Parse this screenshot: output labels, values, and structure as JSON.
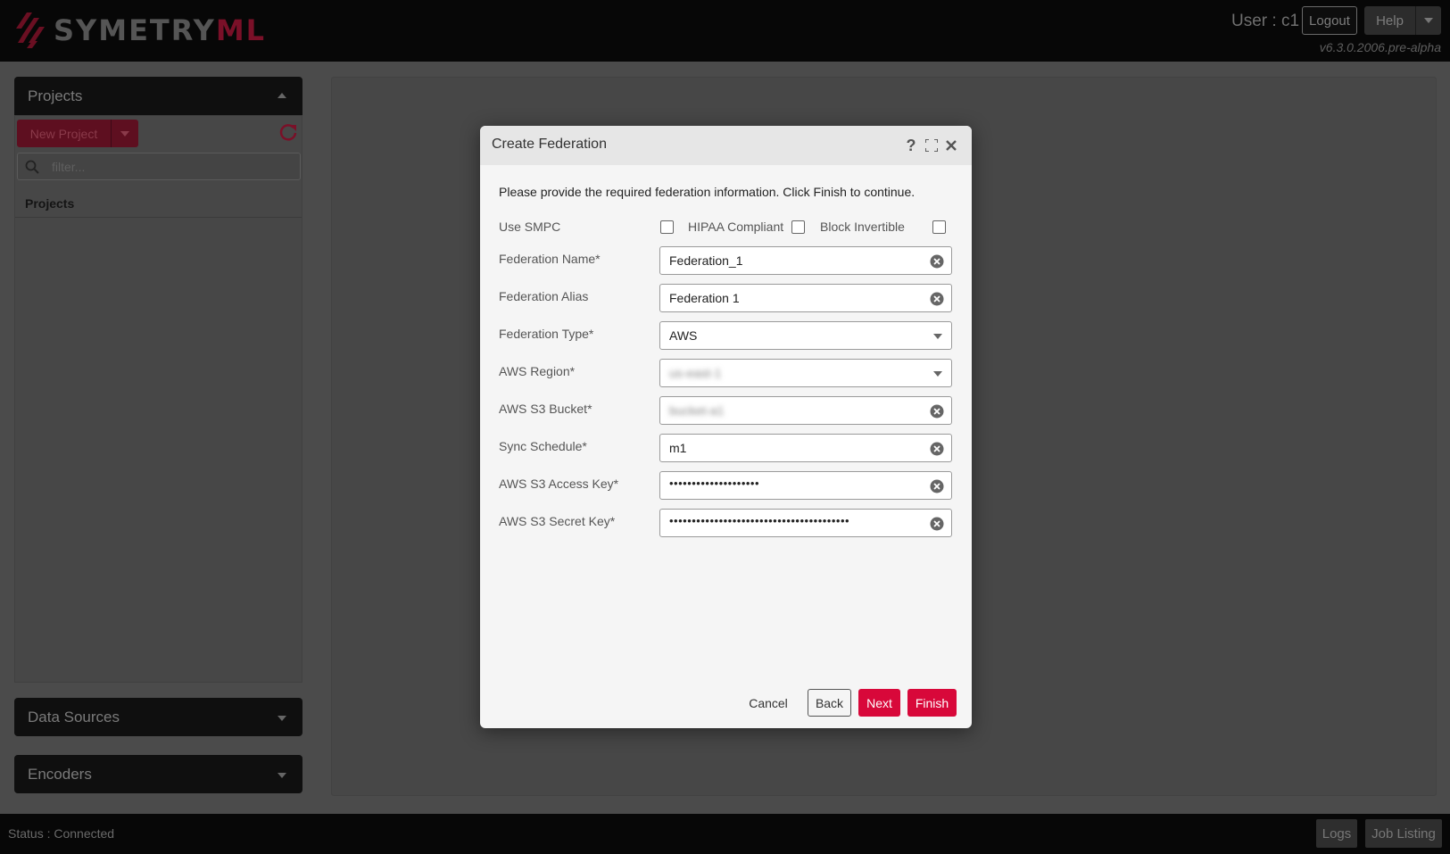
{
  "header": {
    "logo_text_main": "SYMETRY",
    "logo_text_accent": "ML",
    "user_label": "User : c1",
    "logout_label": "Logout",
    "help_label": "Help",
    "version": "v6.3.0.2006.pre-alpha"
  },
  "sidebar": {
    "projects_title": "Projects",
    "new_project_label": "New Project",
    "filter_placeholder": "filter...",
    "list_header": "Projects",
    "data_sources_title": "Data Sources",
    "encoders_title": "Encoders"
  },
  "status": {
    "text": "Status : Connected",
    "logs_label": "Logs",
    "job_listing_label": "Job Listing"
  },
  "modal": {
    "title": "Create Federation",
    "intro": "Please provide the required federation information. Click Finish to continue.",
    "use_smpc_label": "Use SMPC",
    "hipaa_label": "HIPAA Compliant",
    "block_invertible_label": "Block Invertible",
    "fields": {
      "federation_name": {
        "label": "Federation Name*",
        "value": "Federation_1"
      },
      "federation_alias": {
        "label": "Federation Alias",
        "value": "Federation 1"
      },
      "federation_type": {
        "label": "Federation Type*",
        "value": "AWS"
      },
      "aws_region": {
        "label": "AWS Region*",
        "value": "us-east-1"
      },
      "aws_s3_bucket": {
        "label": "AWS S3 Bucket*",
        "value": "bucket-a1"
      },
      "sync_schedule": {
        "label": "Sync Schedule*",
        "value": "m1"
      },
      "aws_s3_access_key": {
        "label": "AWS S3 Access Key*",
        "value": "••••••••••••••••••••"
      },
      "aws_s3_secret_key": {
        "label": "AWS S3 Secret Key*",
        "value": "••••••••••••••••••••••••••••••••••••••••"
      }
    },
    "buttons": {
      "cancel": "Cancel",
      "back": "Back",
      "next": "Next",
      "finish": "Finish"
    }
  },
  "colors": {
    "accent": "#d8083a",
    "header_bg": "#070707",
    "overlay_bg": "#4b4b4b"
  }
}
